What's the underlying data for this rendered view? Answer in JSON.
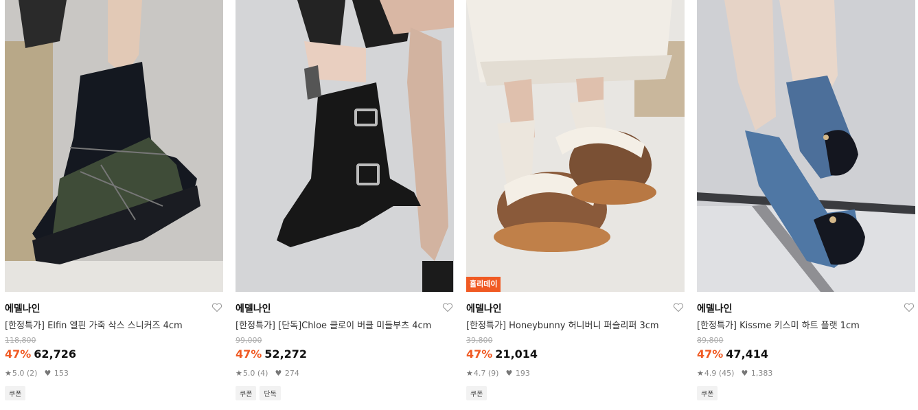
{
  "products": [
    {
      "brand": "에델나인",
      "name": "[한정특가] Elfin 엘핀 가죽 삭스 스니커즈 4cm",
      "original_price": "118,800",
      "discount": "47%",
      "price": "62,726",
      "rating": "5.0",
      "reviews": "(2)",
      "likes": "153",
      "tags": [
        "쿠폰"
      ],
      "badge": "",
      "image_icon": "sock-sneaker-photo"
    },
    {
      "brand": "에델나인",
      "name": "[한정특가] [단독]Chloe 클로이 버클 미들부츠 4cm",
      "original_price": "99,000",
      "discount": "47%",
      "price": "52,272",
      "rating": "5.0",
      "reviews": "(4)",
      "likes": "274",
      "tags": [
        "쿠폰",
        "단독"
      ],
      "badge": "",
      "image_icon": "buckle-boot-photo"
    },
    {
      "brand": "에델나인",
      "name": "[한정특가] Honeybunny 허니버니 퍼슬리퍼 3cm",
      "original_price": "39,800",
      "discount": "47%",
      "price": "21,014",
      "rating": "4.7",
      "reviews": "(9)",
      "likes": "193",
      "tags": [
        "쿠폰"
      ],
      "badge": "홀리데이",
      "image_icon": "fur-slipper-photo"
    },
    {
      "brand": "에델나인",
      "name": "[한정특가] Kissme 키스미 하트 플랫 1cm",
      "original_price": "89,800",
      "discount": "47%",
      "price": "47,414",
      "rating": "4.9",
      "reviews": "(45)",
      "likes": "1,383",
      "tags": [
        "쿠폰"
      ],
      "badge": "",
      "image_icon": "denim-flat-photo"
    }
  ],
  "colors": {
    "accent": "#f05a23",
    "text": "#111111",
    "muted": "#888888",
    "strike": "#aaaaaa"
  }
}
